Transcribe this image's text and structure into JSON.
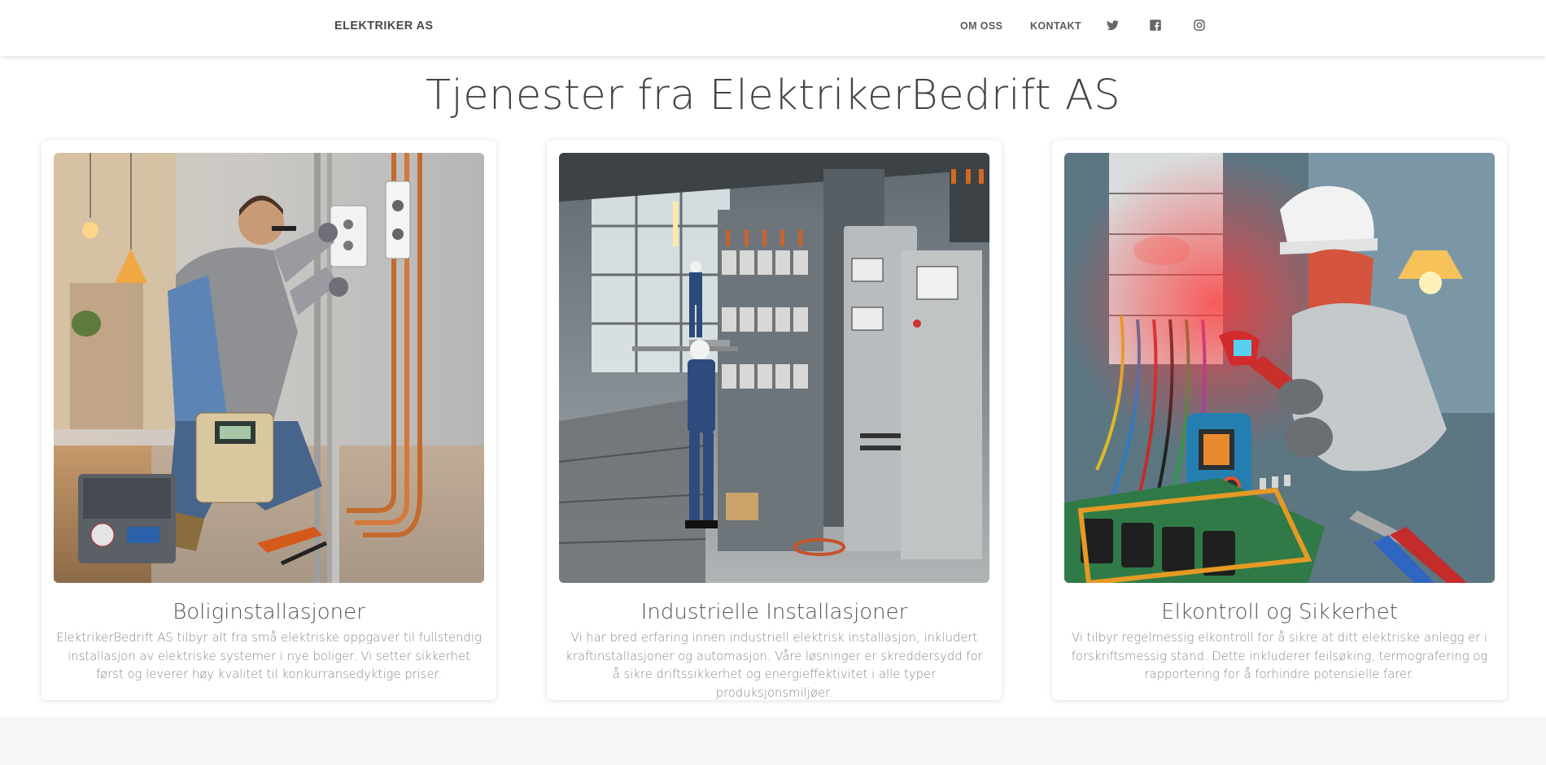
{
  "navbar": {
    "brand": "ELEKTRIKER AS",
    "links": [
      "OM OSS",
      "KONTAKT"
    ],
    "social_icons": [
      "twitter-icon",
      "facebook-icon",
      "instagram-icon"
    ]
  },
  "main": {
    "title": "Tjenester fra ElektrikerBedrift AS",
    "cards": [
      {
        "image": "electrician-residential-installation-photo",
        "title": "Boliginstallasjoner",
        "text": "ElektrikerBedrift AS tilbyr alt fra små elektriske oppgaver til fullstendig installasjon av elektriske systemer i nye boliger. Vi setter sikkerhet først og leverer høy kvalitet til konkurransedyktige priser."
      },
      {
        "image": "industrial-installation-photo",
        "title": "Industrielle Installasjoner",
        "text": "Vi har bred erfaring innen industriell elektrisk installasjon, inkludert kraftinstallasjoner og automasjon. Våre løsninger er skreddersydd for å sikre driftssikkerhet og energieffektivitet i alle typer produksjonsmiljøer."
      },
      {
        "image": "electrical-inspection-photo",
        "title": "Elkontroll og Sikkerhet",
        "text": "Vi tilbyr regelmessig elkontroll for å sikre at ditt elektriske anlegg er i forskriftsmessig stand. Dette inkluderer feilsøking, termografering og rapportering for å forhindre potensielle farer."
      }
    ]
  },
  "colors": {
    "navbar_bg": "#ffffff",
    "page_bg": "#ffffff",
    "footer_bg": "#f6f7f9",
    "title_text": "#444444",
    "body_text": "#8a8a8a"
  }
}
